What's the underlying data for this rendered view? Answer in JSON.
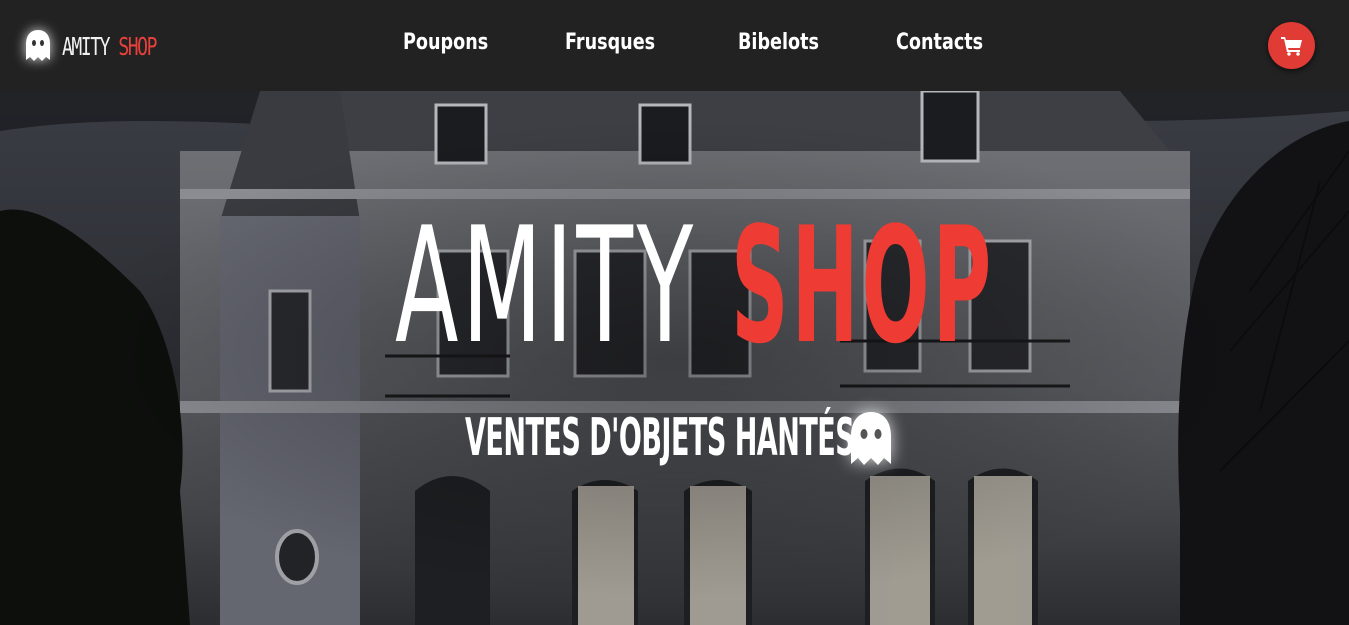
{
  "header": {
    "logo": {
      "word1": "AMITY ",
      "word2": "SHOP",
      "icon": "ghost-icon"
    },
    "nav": [
      {
        "label": "Poupons"
      },
      {
        "label": "Frusques"
      },
      {
        "label": "Bibelots"
      },
      {
        "label": "Contacts"
      }
    ],
    "cart": {
      "icon": "shopping-cart-icon"
    }
  },
  "hero": {
    "title_word1": "AMITY",
    "title_word2": "SHOP",
    "subtitle": "VENTES D'OBJETS HANTÉS",
    "icon": "ghost-icon"
  },
  "colors": {
    "header_bg": "#222222",
    "accent": "#e8403a",
    "cart_bg": "#e03b35",
    "text": "#ffffff"
  }
}
